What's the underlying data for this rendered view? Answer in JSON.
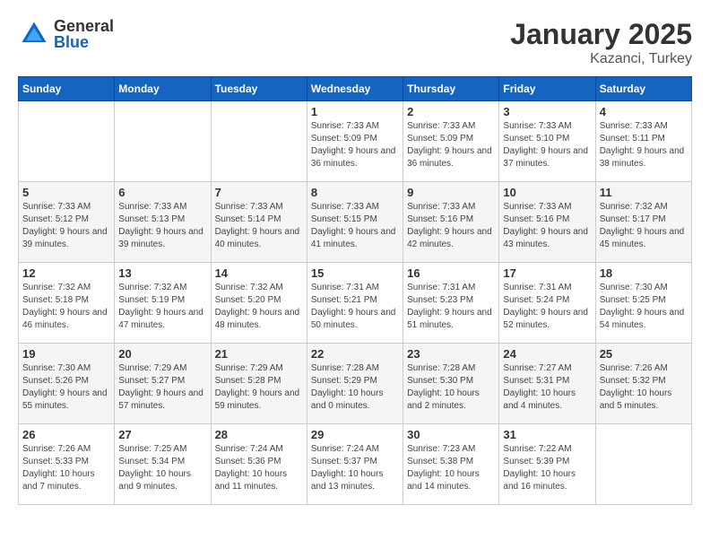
{
  "header": {
    "logo": {
      "general": "General",
      "blue": "Blue"
    },
    "title": "January 2025",
    "location": "Kazanci, Turkey"
  },
  "weekdays": [
    "Sunday",
    "Monday",
    "Tuesday",
    "Wednesday",
    "Thursday",
    "Friday",
    "Saturday"
  ],
  "weeks": [
    [
      {
        "day": "",
        "content": ""
      },
      {
        "day": "",
        "content": ""
      },
      {
        "day": "",
        "content": ""
      },
      {
        "day": "1",
        "content": "Sunrise: 7:33 AM\nSunset: 5:09 PM\nDaylight: 9 hours and 36 minutes."
      },
      {
        "day": "2",
        "content": "Sunrise: 7:33 AM\nSunset: 5:09 PM\nDaylight: 9 hours and 36 minutes."
      },
      {
        "day": "3",
        "content": "Sunrise: 7:33 AM\nSunset: 5:10 PM\nDaylight: 9 hours and 37 minutes."
      },
      {
        "day": "4",
        "content": "Sunrise: 7:33 AM\nSunset: 5:11 PM\nDaylight: 9 hours and 38 minutes."
      }
    ],
    [
      {
        "day": "5",
        "content": "Sunrise: 7:33 AM\nSunset: 5:12 PM\nDaylight: 9 hours and 39 minutes."
      },
      {
        "day": "6",
        "content": "Sunrise: 7:33 AM\nSunset: 5:13 PM\nDaylight: 9 hours and 39 minutes."
      },
      {
        "day": "7",
        "content": "Sunrise: 7:33 AM\nSunset: 5:14 PM\nDaylight: 9 hours and 40 minutes."
      },
      {
        "day": "8",
        "content": "Sunrise: 7:33 AM\nSunset: 5:15 PM\nDaylight: 9 hours and 41 minutes."
      },
      {
        "day": "9",
        "content": "Sunrise: 7:33 AM\nSunset: 5:16 PM\nDaylight: 9 hours and 42 minutes."
      },
      {
        "day": "10",
        "content": "Sunrise: 7:33 AM\nSunset: 5:16 PM\nDaylight: 9 hours and 43 minutes."
      },
      {
        "day": "11",
        "content": "Sunrise: 7:32 AM\nSunset: 5:17 PM\nDaylight: 9 hours and 45 minutes."
      }
    ],
    [
      {
        "day": "12",
        "content": "Sunrise: 7:32 AM\nSunset: 5:18 PM\nDaylight: 9 hours and 46 minutes."
      },
      {
        "day": "13",
        "content": "Sunrise: 7:32 AM\nSunset: 5:19 PM\nDaylight: 9 hours and 47 minutes."
      },
      {
        "day": "14",
        "content": "Sunrise: 7:32 AM\nSunset: 5:20 PM\nDaylight: 9 hours and 48 minutes."
      },
      {
        "day": "15",
        "content": "Sunrise: 7:31 AM\nSunset: 5:21 PM\nDaylight: 9 hours and 50 minutes."
      },
      {
        "day": "16",
        "content": "Sunrise: 7:31 AM\nSunset: 5:23 PM\nDaylight: 9 hours and 51 minutes."
      },
      {
        "day": "17",
        "content": "Sunrise: 7:31 AM\nSunset: 5:24 PM\nDaylight: 9 hours and 52 minutes."
      },
      {
        "day": "18",
        "content": "Sunrise: 7:30 AM\nSunset: 5:25 PM\nDaylight: 9 hours and 54 minutes."
      }
    ],
    [
      {
        "day": "19",
        "content": "Sunrise: 7:30 AM\nSunset: 5:26 PM\nDaylight: 9 hours and 55 minutes."
      },
      {
        "day": "20",
        "content": "Sunrise: 7:29 AM\nSunset: 5:27 PM\nDaylight: 9 hours and 57 minutes."
      },
      {
        "day": "21",
        "content": "Sunrise: 7:29 AM\nSunset: 5:28 PM\nDaylight: 9 hours and 59 minutes."
      },
      {
        "day": "22",
        "content": "Sunrise: 7:28 AM\nSunset: 5:29 PM\nDaylight: 10 hours and 0 minutes."
      },
      {
        "day": "23",
        "content": "Sunrise: 7:28 AM\nSunset: 5:30 PM\nDaylight: 10 hours and 2 minutes."
      },
      {
        "day": "24",
        "content": "Sunrise: 7:27 AM\nSunset: 5:31 PM\nDaylight: 10 hours and 4 minutes."
      },
      {
        "day": "25",
        "content": "Sunrise: 7:26 AM\nSunset: 5:32 PM\nDaylight: 10 hours and 5 minutes."
      }
    ],
    [
      {
        "day": "26",
        "content": "Sunrise: 7:26 AM\nSunset: 5:33 PM\nDaylight: 10 hours and 7 minutes."
      },
      {
        "day": "27",
        "content": "Sunrise: 7:25 AM\nSunset: 5:34 PM\nDaylight: 10 hours and 9 minutes."
      },
      {
        "day": "28",
        "content": "Sunrise: 7:24 AM\nSunset: 5:36 PM\nDaylight: 10 hours and 11 minutes."
      },
      {
        "day": "29",
        "content": "Sunrise: 7:24 AM\nSunset: 5:37 PM\nDaylight: 10 hours and 13 minutes."
      },
      {
        "day": "30",
        "content": "Sunrise: 7:23 AM\nSunset: 5:38 PM\nDaylight: 10 hours and 14 minutes."
      },
      {
        "day": "31",
        "content": "Sunrise: 7:22 AM\nSunset: 5:39 PM\nDaylight: 10 hours and 16 minutes."
      },
      {
        "day": "",
        "content": ""
      }
    ]
  ]
}
